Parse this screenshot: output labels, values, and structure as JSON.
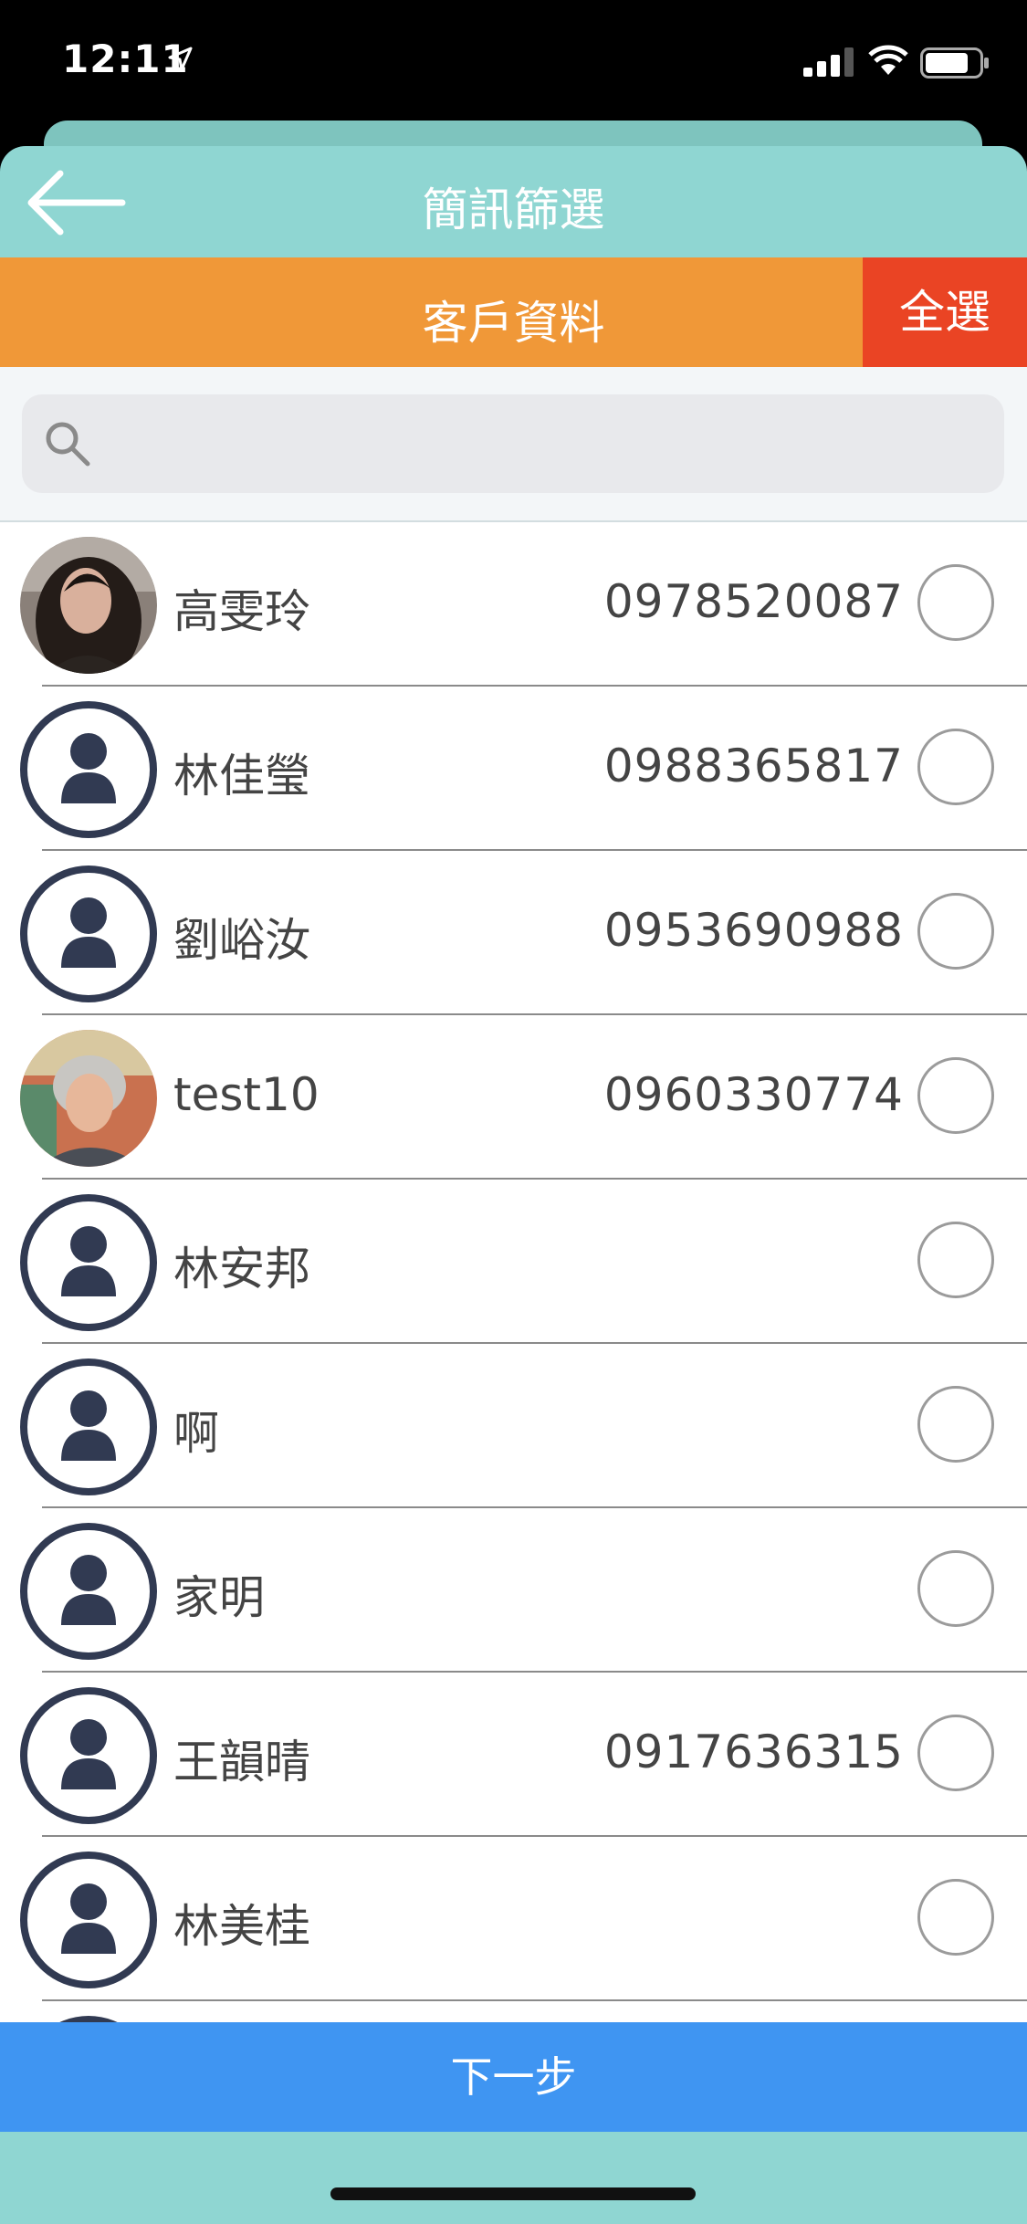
{
  "status_bar": {
    "time": "12:11"
  },
  "nav": {
    "title": "簡訊篩選"
  },
  "section": {
    "title": "客戶資料",
    "select_all_label": "全選"
  },
  "search": {
    "placeholder": ""
  },
  "contacts": [
    {
      "name": "高雯玲",
      "phone": "0978520087",
      "avatar": "photo-woman",
      "selected": false
    },
    {
      "name": "林佳瑩",
      "phone": "0988365817",
      "avatar": "default-person-icon",
      "selected": false
    },
    {
      "name": "劉峪汝",
      "phone": "0953690988",
      "avatar": "default-person-icon",
      "selected": false
    },
    {
      "name": "test10",
      "phone": "0960330774",
      "avatar": "photo-man",
      "selected": false
    },
    {
      "name": "林安邦",
      "phone": "",
      "avatar": "default-person-icon",
      "selected": false
    },
    {
      "name": "啊",
      "phone": "",
      "avatar": "default-person-icon",
      "selected": false
    },
    {
      "name": "家明",
      "phone": "",
      "avatar": "default-person-icon",
      "selected": false
    },
    {
      "name": "王韻晴",
      "phone": "0917636315",
      "avatar": "default-person-icon",
      "selected": false
    },
    {
      "name": "林美桂",
      "phone": "",
      "avatar": "default-person-icon",
      "selected": false
    }
  ],
  "footer": {
    "next_label": "下一步"
  },
  "colors": {
    "sheet": "#8fd6d2",
    "section_bar": "#f09838",
    "select_all": "#ea4424",
    "next_button": "#3f95f2",
    "avatar_icon": "#313a52"
  }
}
